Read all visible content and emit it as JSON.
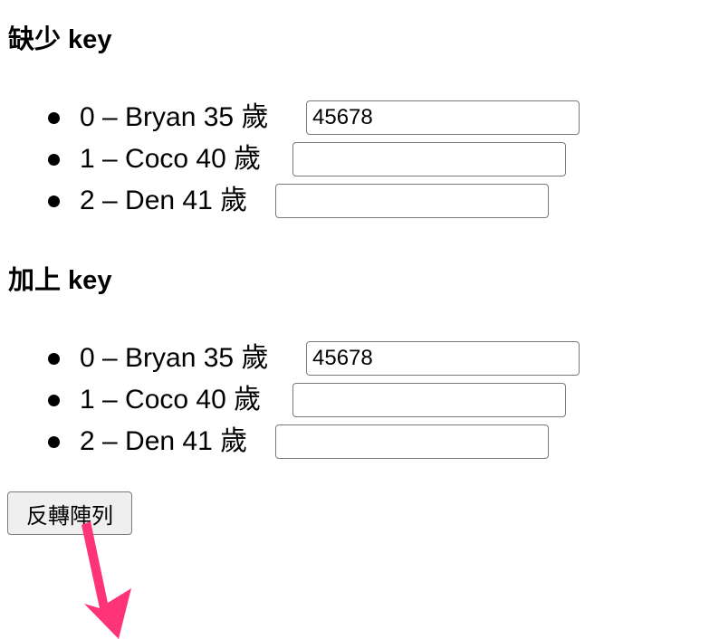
{
  "sections": [
    {
      "title": "缺少 key",
      "items": [
        {
          "label": "0 – Bryan 35 歲",
          "value": "45678",
          "placeholder": ""
        },
        {
          "label": "1 – Coco 40 歲",
          "value": "",
          "placeholder": ""
        },
        {
          "label": "2 – Den 41 歲",
          "value": "",
          "placeholder": ""
        }
      ]
    },
    {
      "title": "加上 key",
      "items": [
        {
          "label": "0 – Bryan 35 歲",
          "value": "45678",
          "placeholder": ""
        },
        {
          "label": "1 – Coco 40 歲",
          "value": "",
          "placeholder": ""
        },
        {
          "label": "2 – Den 41 歲",
          "value": "",
          "placeholder": ""
        }
      ]
    }
  ],
  "reverse_button": {
    "label": "反轉陣列"
  },
  "colors": {
    "annotation_arrow": "#ff3377",
    "button_bg": "#efefef",
    "input_border": "#7a7a7a"
  },
  "icons": {
    "annotation": "arrow-annotation-icon"
  }
}
